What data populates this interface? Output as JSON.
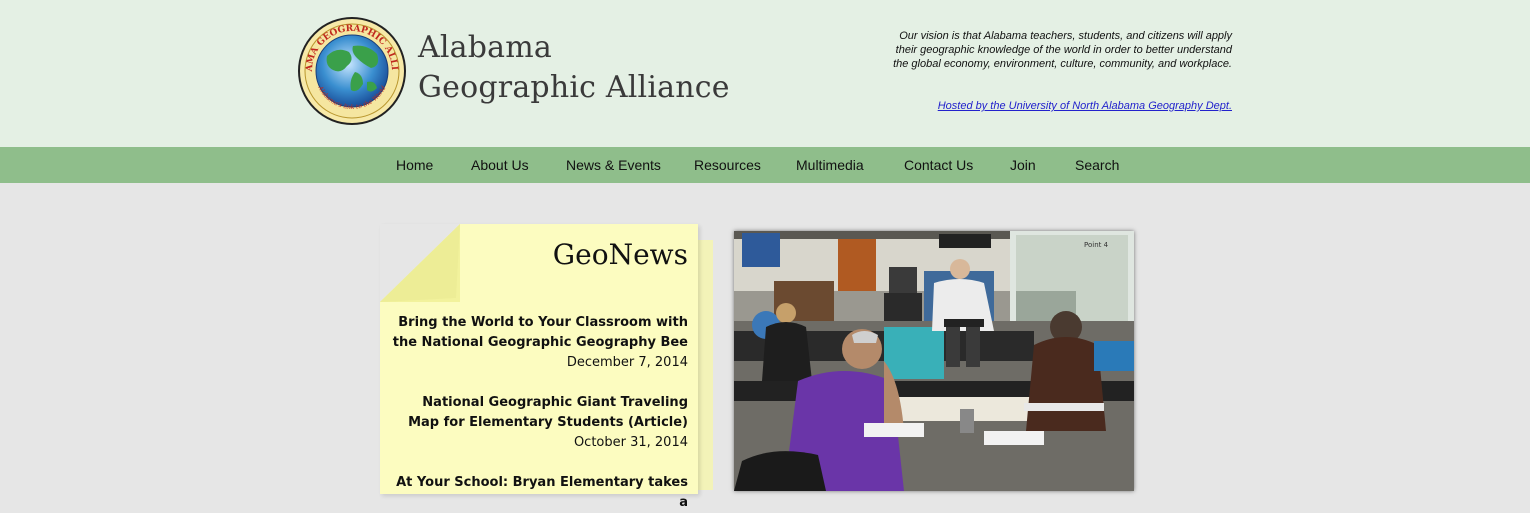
{
  "header": {
    "logo": {
      "icon": "globe-icon",
      "ring_text": "ALABAMA GEOGRAPHIC ALLIANCE",
      "motto": "Alabama's link to the World"
    },
    "site_title_line1": "Alabama",
    "site_title_line2": "Geographic Alliance",
    "vision": "Our vision is that Alabama teachers, students, and citizens will apply their geographic knowledge of the world in order to better understand the global economy, environment, culture, community, and workplace.",
    "hosted_link": "Hosted by the University of North Alabama Geography Dept."
  },
  "nav": {
    "home": "Home",
    "about": "About Us",
    "news": "News & Events",
    "resources": "Resources",
    "multimedia": "Multimedia",
    "contact": "Contact Us",
    "join": "Join",
    "search": "Search"
  },
  "geonews": {
    "title": "GeoNews",
    "items": [
      {
        "title": "Bring the World to Your Classroom with the National Geographic Geography Bee",
        "date": "December 7, 2014"
      },
      {
        "title": "National Geographic Giant Traveling Map for Elementary Students (Article)",
        "date": "October 31, 2014"
      },
      {
        "title": "At Your School: Bryan Elementary takes a"
      }
    ]
  },
  "photo": {
    "screen_text": "Point 4"
  },
  "colors": {
    "header_bg": "#e4f0e4",
    "nav_bg": "#8fbe8b",
    "note_bg": "#fcfcc0",
    "link": "#2222cc"
  }
}
